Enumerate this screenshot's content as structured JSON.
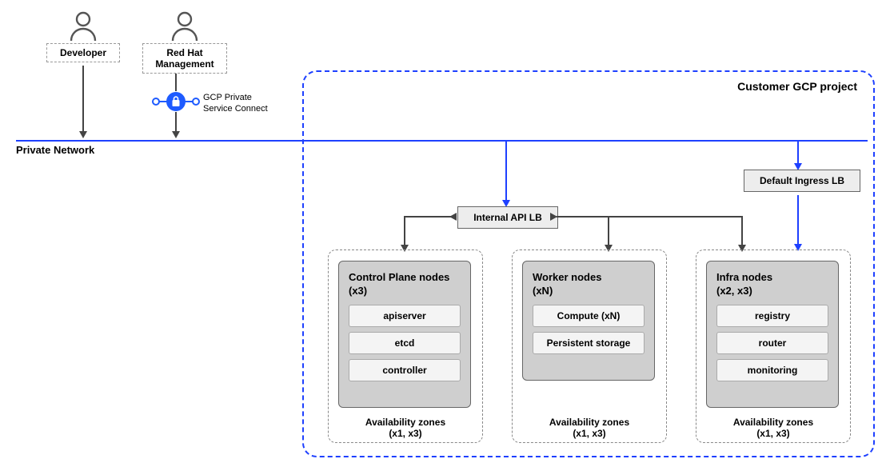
{
  "actors": {
    "developer": "Developer",
    "redhat": "Red Hat\nManagement"
  },
  "psc_label": "GCP Private\nService Connect",
  "network_label": "Private Network",
  "project_title": "Customer GCP project",
  "load_balancers": {
    "internal": "Internal API LB",
    "ingress": "Default Ingress LB"
  },
  "zones_caption": "Availability zones",
  "zone_groups": {
    "control": {
      "title": "Control Plane nodes",
      "count": "(x3)",
      "items": [
        "apiserver",
        "etcd",
        "controller"
      ],
      "zones": "(x1, x3)"
    },
    "worker": {
      "title": "Worker nodes",
      "count": "(xN)",
      "items": [
        "Compute (xN)",
        "Persistent storage"
      ],
      "zones": "(x1, x3)"
    },
    "infra": {
      "title": "Infra nodes",
      "count": "(x2, x3)",
      "items": [
        "registry",
        "router",
        "monitoring"
      ],
      "zones": "(x1, x3)"
    }
  }
}
